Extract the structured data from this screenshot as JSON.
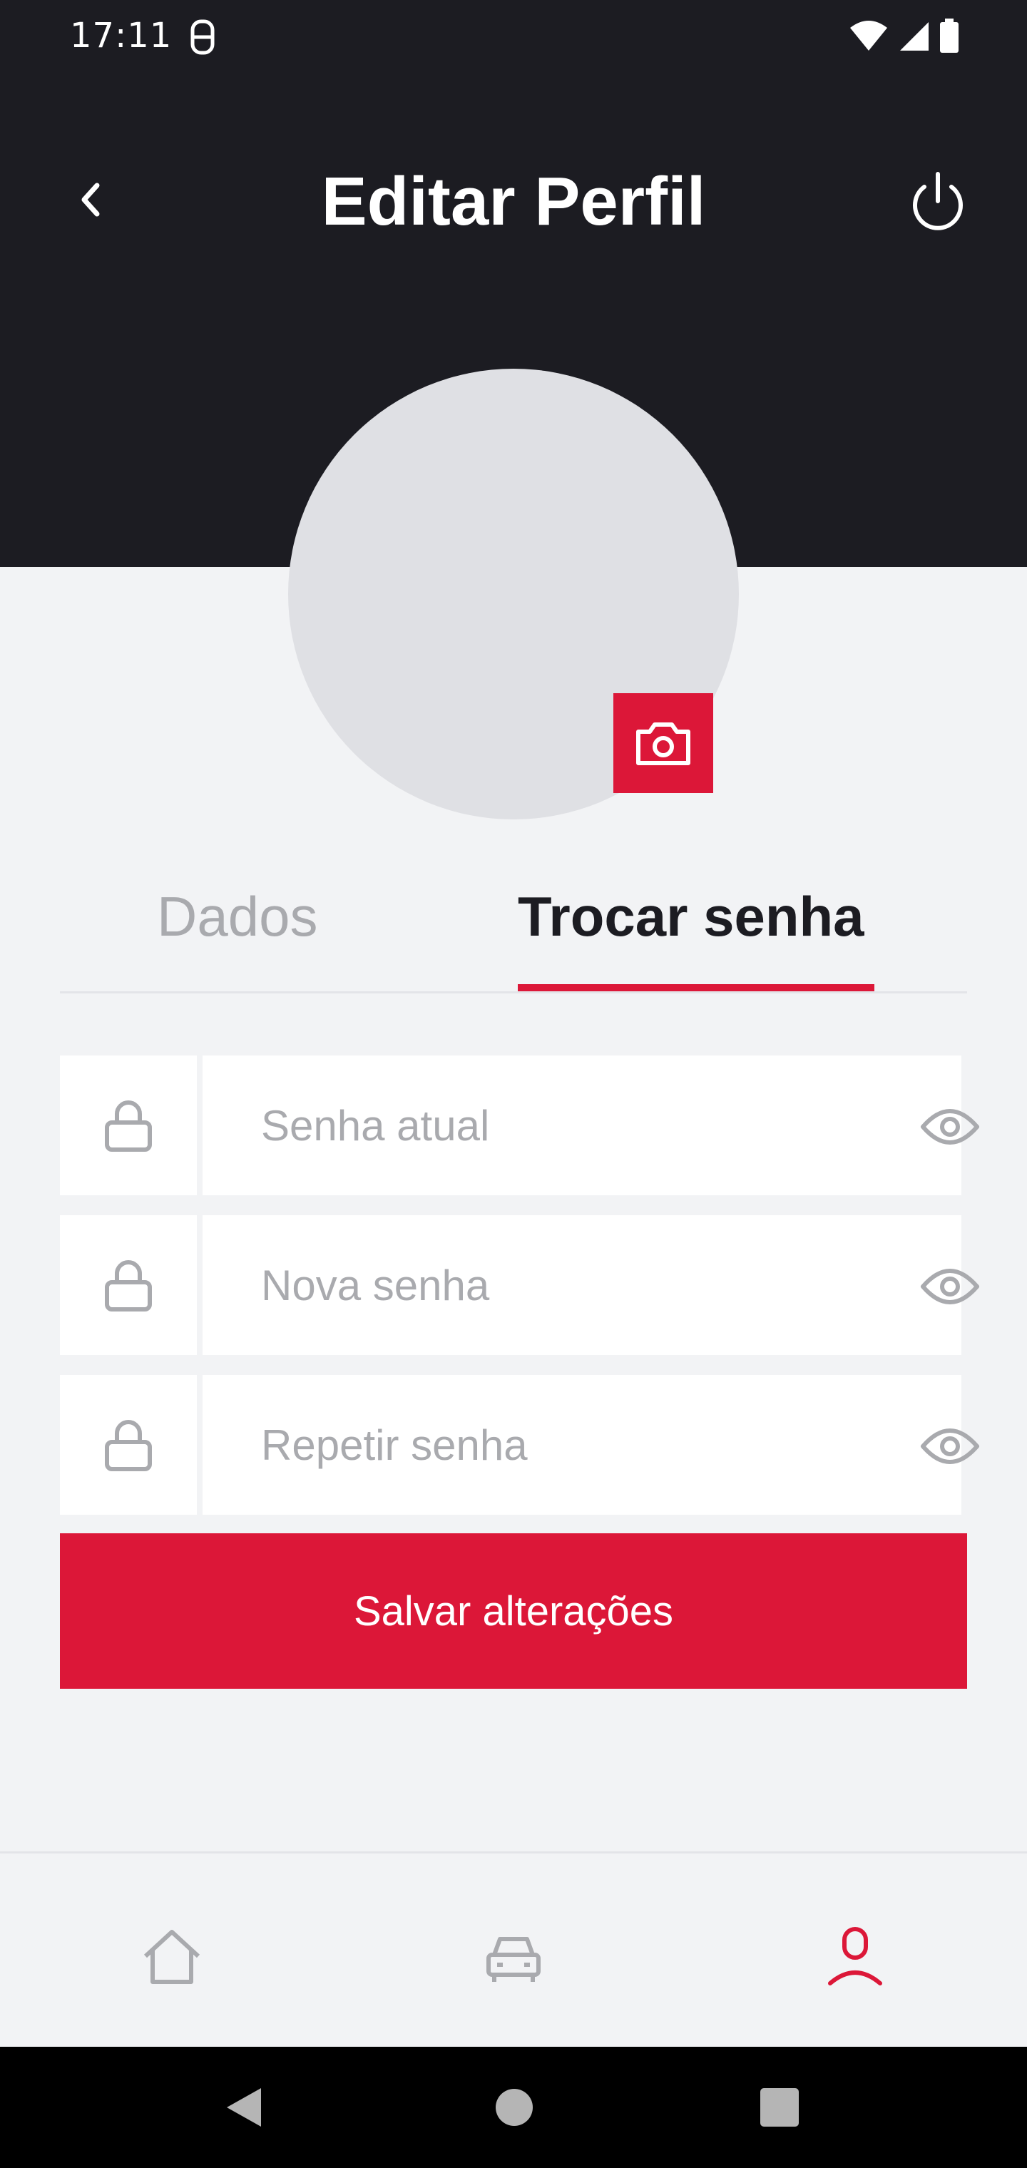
{
  "status_bar": {
    "time": "17:11",
    "icons": [
      "sim-card-icon",
      "wifi-icon",
      "signal-icon",
      "battery-icon"
    ]
  },
  "header": {
    "title": "Editar Perfil",
    "back_icon": "chevron-left-icon",
    "power_icon": "power-icon"
  },
  "avatar": {
    "camera_icon": "camera-icon"
  },
  "tabs": [
    {
      "label": "Dados",
      "active": false
    },
    {
      "label": "Trocar senha",
      "active": true
    }
  ],
  "form": {
    "fields": [
      {
        "placeholder": "Senha atual",
        "value": "",
        "icon": "lock-icon",
        "toggle_icon": "eye-icon"
      },
      {
        "placeholder": "Nova senha",
        "value": "",
        "icon": "lock-icon",
        "toggle_icon": "eye-icon"
      },
      {
        "placeholder": "Repetir senha",
        "value": "",
        "icon": "lock-icon",
        "toggle_icon": "eye-icon"
      }
    ],
    "save_label": "Salvar alterações"
  },
  "bottom_nav": {
    "items": [
      {
        "icon": "home-icon",
        "active": false
      },
      {
        "icon": "car-icon",
        "active": false
      },
      {
        "icon": "user-icon",
        "active": true
      }
    ]
  },
  "colors": {
    "header_bg": "#1c1c22",
    "accent": "#dc1738",
    "page_bg": "#f2f3f5",
    "muted_text": "#a9aaae",
    "avatar_bg": "#dfe0e4"
  }
}
